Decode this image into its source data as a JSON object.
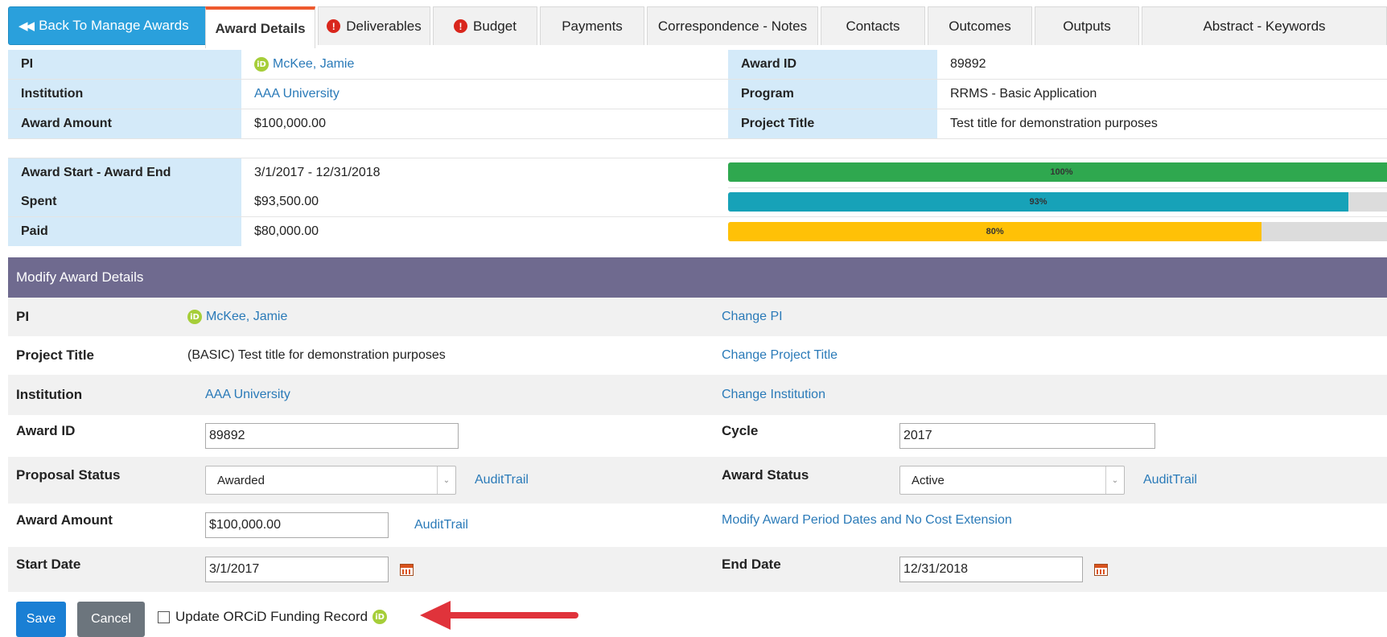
{
  "tabs": {
    "back": "Back To Manage Awards",
    "items": [
      {
        "label": "Award Details",
        "error": false,
        "active": true
      },
      {
        "label": "Deliverables",
        "error": true
      },
      {
        "label": "Budget",
        "error": true
      },
      {
        "label": "Payments",
        "error": false
      },
      {
        "label": "Correspondence - Notes",
        "error": false
      },
      {
        "label": "Contacts",
        "error": false
      },
      {
        "label": "Outcomes",
        "error": false
      },
      {
        "label": "Outputs",
        "error": false
      },
      {
        "label": "Abstract - Keywords",
        "error": false
      }
    ]
  },
  "summary": {
    "pi_label": "PI",
    "pi_value": "McKee, Jamie",
    "institution_label": "Institution",
    "institution_value": "AAA University",
    "amount_label": "Award Amount",
    "amount_value": "$100,000.00",
    "award_id_label": "Award ID",
    "award_id_value": "89892",
    "program_label": "Program",
    "program_value": "RRMS - Basic Application",
    "project_title_label": "Project Title",
    "project_title_value": "Test title for demonstration purposes"
  },
  "progress": {
    "dates_label": "Award Start - Award End",
    "dates_value": "3/1/2017 - 12/31/2018",
    "spent_label": "Spent",
    "spent_value": "$93,500.00",
    "paid_label": "Paid",
    "paid_value": "$80,000.00",
    "bars": [
      {
        "percent": 100,
        "text": "100%",
        "color": "#2fa84f"
      },
      {
        "percent": 93,
        "text": "93%",
        "color": "#17a2b8"
      },
      {
        "percent": 80,
        "text": "80%",
        "color": "#ffc107"
      }
    ]
  },
  "modify": {
    "header": "Modify Award Details",
    "pi_label": "PI",
    "pi_value": "McKee, Jamie",
    "change_pi": "Change PI",
    "title_label": "Project Title",
    "title_value": "(BASIC) Test title for demonstration purposes",
    "change_title": "Change Project Title",
    "inst_label": "Institution",
    "inst_value": "AAA University",
    "change_inst": "Change Institution",
    "award_id_label": "Award ID",
    "award_id_value": "89892",
    "cycle_label": "Cycle",
    "cycle_value": "2017",
    "proposal_status_label": "Proposal Status",
    "proposal_status_value": "Awarded",
    "award_status_label": "Award Status",
    "award_status_value": "Active",
    "audit_trail": "AuditTrail",
    "amount_label": "Award Amount",
    "amount_value": "$100,000.00",
    "modify_period": "Modify Award Period Dates and No Cost Extension",
    "start_label": "Start Date",
    "start_value": "3/1/2017",
    "end_label": "End Date",
    "end_value": "12/31/2018"
  },
  "footer": {
    "save": "Save",
    "cancel": "Cancel",
    "orcid_checkbox": "Update ORCiD Funding Record",
    "orcid_checked": false
  },
  "icons": {
    "orcid": "iD",
    "error": "!"
  },
  "colors": {
    "accent": "#2aa0dc",
    "header_purple": "#6f6a8f",
    "label_blue": "#d4eaf9",
    "annotation_arrow": "#e0333b"
  }
}
